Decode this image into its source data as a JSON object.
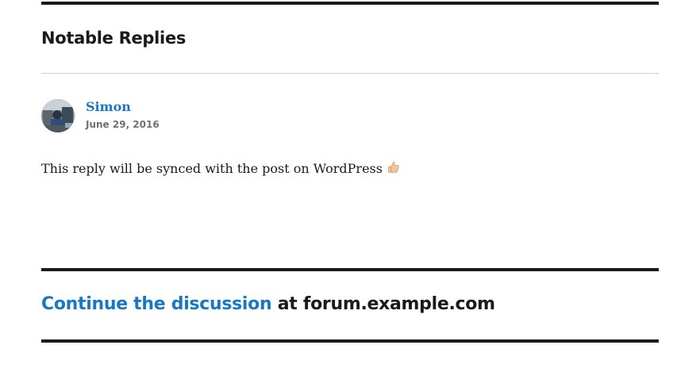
{
  "replies_section": {
    "title": "Notable Replies",
    "replies": [
      {
        "author": "Simon",
        "date": "June 29, 2016",
        "body": "This reply will be synced with the post on WordPress",
        "emoji": "thumbs-up-icon"
      }
    ]
  },
  "footer": {
    "continue_link": "Continue the discussion",
    "continue_rest": " at forum.example.com"
  },
  "colors": {
    "link": "#1a78c2",
    "text": "#1a1a1a",
    "muted": "#707070",
    "rule": "#1a1a1a",
    "divider": "#d1d1d1"
  }
}
